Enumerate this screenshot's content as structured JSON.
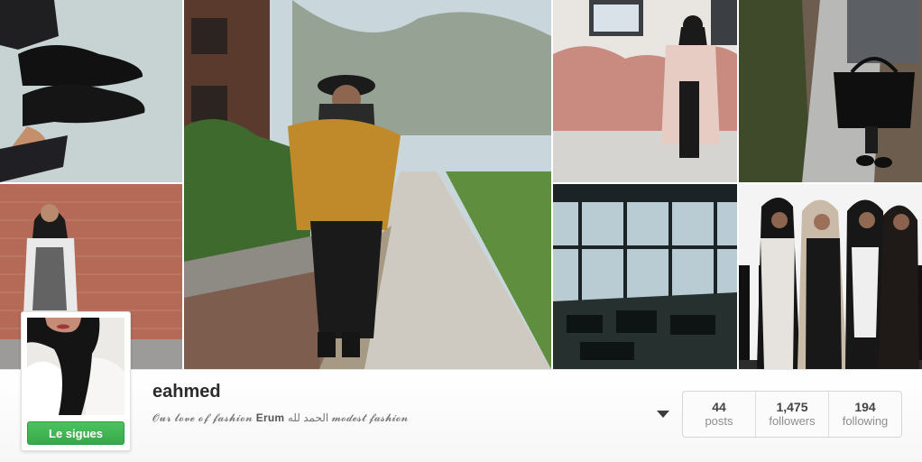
{
  "profile": {
    "username": "eahmed",
    "bio_prefix": "𝓞𝓾𝓻 𝓵𝓸𝓿𝓮 𝓸𝓯 𝓯𝓪𝓼𝓱𝓲𝓸𝓷 ",
    "bio_name": "Erum",
    "bio_arabic": " الحمد لله ",
    "bio_suffix": "𝓶𝓸𝓭𝓮𝓼𝓽 𝓯𝓪𝓼𝓱𝓲𝓸𝓷",
    "follow_label": "Le sigues"
  },
  "stats": [
    {
      "value": "44",
      "label": "posts"
    },
    {
      "value": "1,475",
      "label": "followers"
    },
    {
      "value": "194",
      "label": "following"
    }
  ],
  "colors": {
    "follow_green": "#3fb553",
    "text_dark": "#2c2c2c",
    "text_muted": "#8e8e8e"
  },
  "icons": {
    "menu": "chevron-down-icon"
  }
}
